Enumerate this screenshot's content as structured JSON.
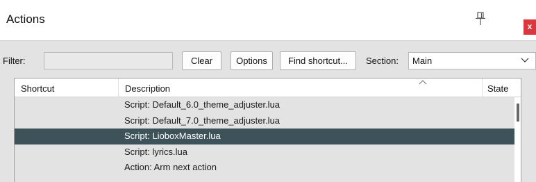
{
  "window": {
    "title": "Actions",
    "close_label": "x"
  },
  "toolbar": {
    "filter_label": "Filter:",
    "filter_value": "",
    "clear_label": "Clear",
    "options_label": "Options",
    "find_shortcut_label": "Find shortcut...",
    "section_label": "Section:",
    "section_value": "Main"
  },
  "table": {
    "columns": {
      "shortcut": "Shortcut",
      "description": "Description",
      "state": "State"
    },
    "sorted_column": "Description",
    "rows": [
      {
        "shortcut": "",
        "description": "Script: Default_6.0_theme_adjuster.lua",
        "state": ""
      },
      {
        "shortcut": "",
        "description": "Script: Default_7.0_theme_adjuster.lua",
        "state": ""
      },
      {
        "shortcut": "",
        "description": "Script: LioboxMaster.lua",
        "state": "",
        "selected": true
      },
      {
        "shortcut": "",
        "description": "Script: lyrics.lua",
        "state": ""
      },
      {
        "shortcut": "",
        "description": "Action: Arm next action",
        "state": ""
      }
    ]
  },
  "colors": {
    "panel_bg": "#e3e3e3",
    "selected_row_bg": "#3e5259",
    "close_button_bg": "#d9363e"
  },
  "icons": {
    "pin": "pin-icon",
    "close": "close-icon",
    "dropdown": "chevron-down-icon",
    "sort": "sort-ascending-icon"
  }
}
